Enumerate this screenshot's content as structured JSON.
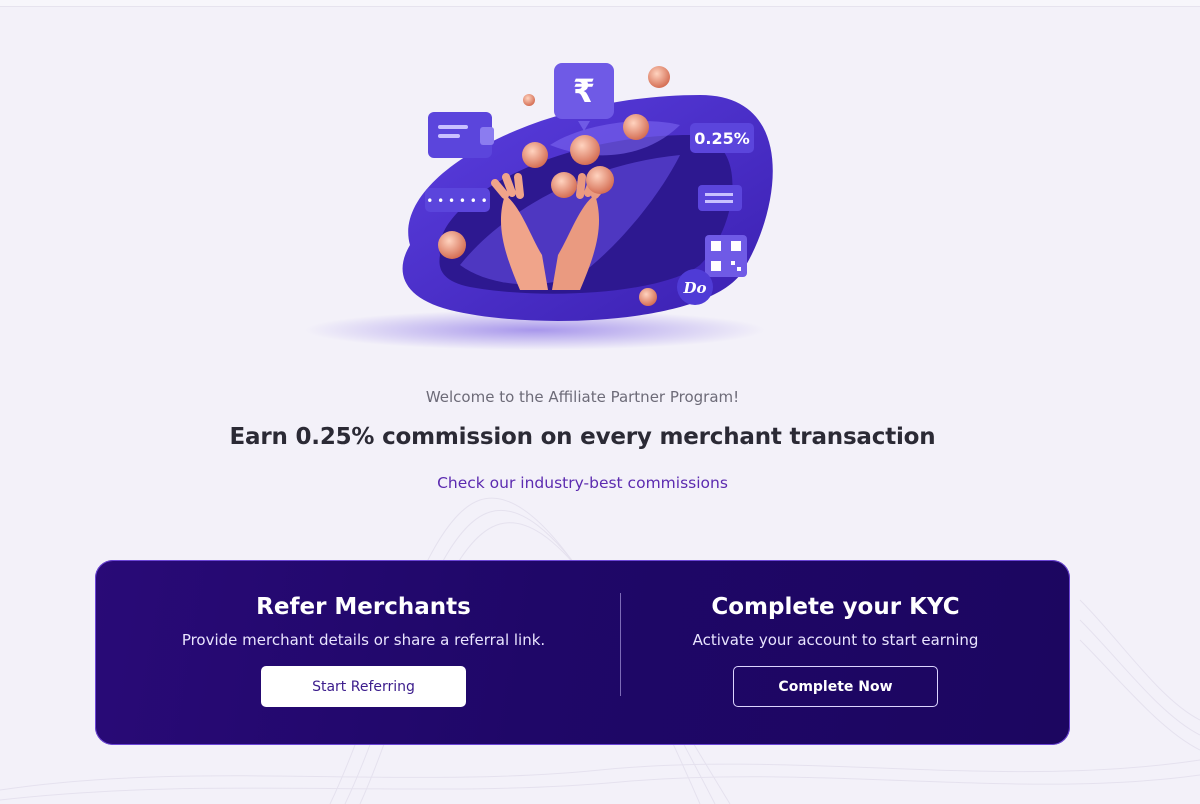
{
  "hero": {
    "rupee_symbol": "₹",
    "percent_badge": "0.25%",
    "brand_coin": "Do"
  },
  "welcome_text": "Welcome to the Affiliate Partner Program!",
  "headline": "Earn 0.25% commission on every merchant transaction",
  "commission_link": "Check our industry-best commissions",
  "cards": {
    "refer": {
      "title": "Refer Merchants",
      "description": "Provide merchant details or share a referral link.",
      "button_label": "Start Referring"
    },
    "kyc": {
      "title": "Complete your KYC",
      "description": "Activate your account to start earning",
      "button_label": "Complete Now"
    }
  },
  "colors": {
    "page_bg": "#f3f1f9",
    "card_bg": "#230867",
    "accent": "#5c2bb0",
    "ribbon": "#4b2fc8",
    "coin": "#e08a70"
  }
}
